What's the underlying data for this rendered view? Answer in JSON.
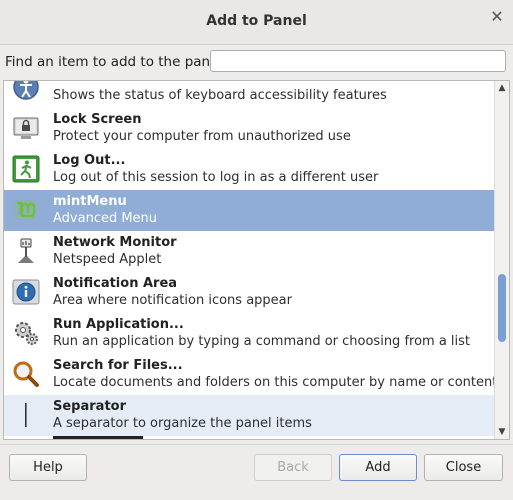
{
  "window": {
    "title": "Add to Panel"
  },
  "search": {
    "label": "Find an item to add to the panel:",
    "value": "",
    "placeholder": ""
  },
  "items": [
    {
      "name": "",
      "desc": "Shows the status of keyboard accessibility features",
      "icon": "accessibility-icon"
    },
    {
      "name": "Lock Screen",
      "desc": "Protect your computer from unauthorized use",
      "icon": "lock-screen-icon"
    },
    {
      "name": "Log Out...",
      "desc": "Log out of this session to log in as a different user",
      "icon": "log-out-icon"
    },
    {
      "name": "mintMenu",
      "desc": "Advanced Menu",
      "icon": "mint-menu-icon"
    },
    {
      "name": "Network Monitor",
      "desc": "Netspeed Applet",
      "icon": "network-monitor-icon"
    },
    {
      "name": "Notification Area",
      "desc": "Area where notification icons appear",
      "icon": "notification-area-icon"
    },
    {
      "name": "Run Application...",
      "desc": "Run an application by typing a command or choosing from a list",
      "icon": "run-application-icon"
    },
    {
      "name": "Search for Files...",
      "desc": "Locate documents and folders on this computer by name or content",
      "icon": "search-files-icon"
    },
    {
      "name": "Separator",
      "desc": "A separator to organize the panel items",
      "icon": "separator-icon"
    }
  ],
  "selected_index": 3,
  "buttons": {
    "help": "Help",
    "back": "Back",
    "add": "Add",
    "close": "Close"
  },
  "colors": {
    "selection": "#8fadd6",
    "accent": "#7a9fd4"
  }
}
